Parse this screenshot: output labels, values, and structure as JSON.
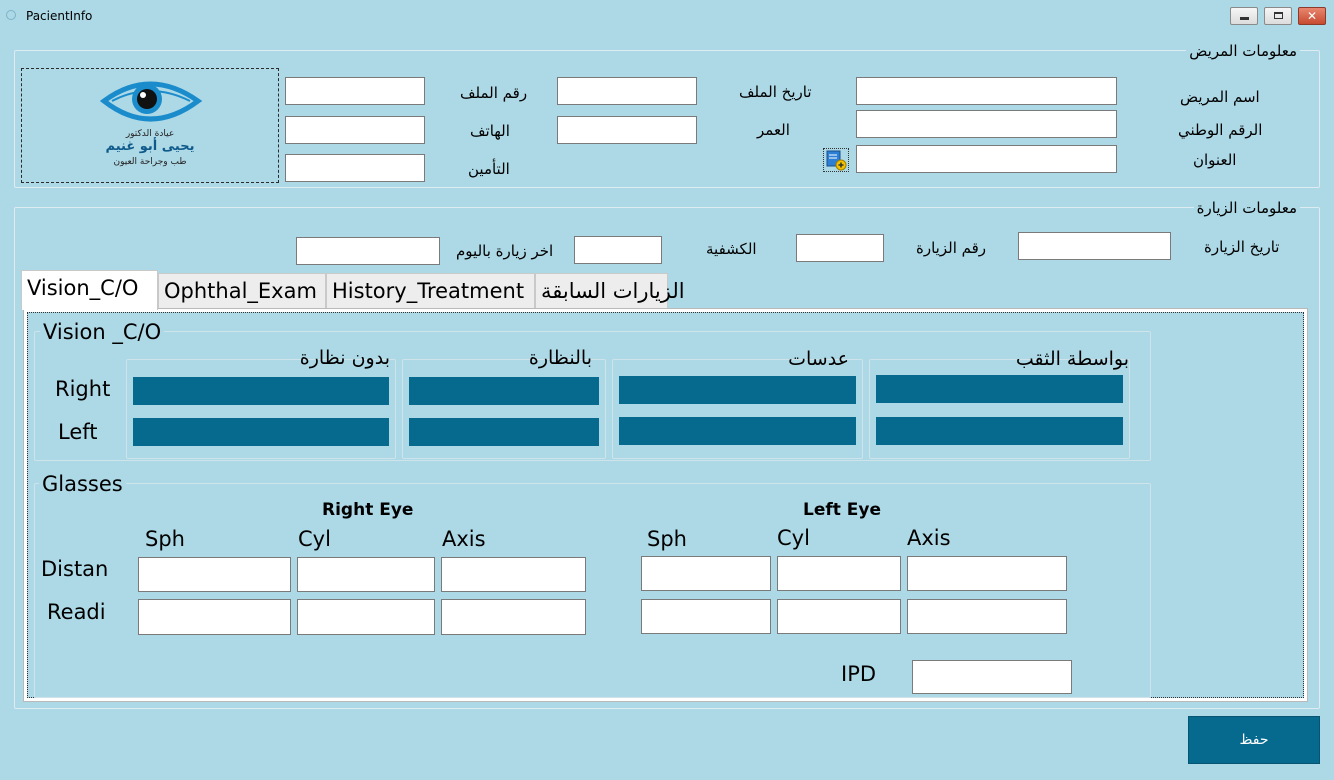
{
  "window": {
    "title": "PacientInfo"
  },
  "patient": {
    "legend": "معلومات المريض",
    "name_label": "اسم المريض",
    "national_id_label": "الرقم الوطني",
    "address_label": "العنوان",
    "file_date_label": "تاريخ الملف",
    "age_label": "العمر",
    "file_no_label": "رقم الملف",
    "phone_label": "الهاتف",
    "insurance_label": "التأمين"
  },
  "logo": {
    "line1": "عيادة الدكتور",
    "line2": "يحيى أبو غنيم",
    "line3": "طب وجراحة العيون"
  },
  "visit": {
    "legend": "معلومات الزيارة",
    "date_label": "تاريخ الزيارة",
    "visit_no_label": "رقم الزيارة",
    "fee_label": "الكشفية",
    "last_visit_label": "اخر زيارة باليوم"
  },
  "tabs": [
    {
      "label": "Vision_C/O",
      "active": true
    },
    {
      "label": "Ophthal_Exam",
      "active": false
    },
    {
      "label": "History_Treatment",
      "active": false
    },
    {
      "label": "الزيارات السابقة",
      "active": false
    }
  ],
  "vision": {
    "legend": "Vision _C/O",
    "right_label": "Right",
    "left_label": "Left",
    "columns": [
      "بدون نظارة",
      "بالنظارة",
      "عدسات",
      "بواسطة الثقب"
    ]
  },
  "glasses": {
    "legend": "Glasses",
    "right_eye_title": "Right Eye",
    "left_eye_title": "Left Eye",
    "sph": "Sph",
    "cyl": "Cyl",
    "axis": "Axis",
    "distance_label": "Distan",
    "reading_label": "Readi",
    "ipd_label": "IPD"
  },
  "save_label": "حفظ",
  "colors": {
    "background": "#add8e6",
    "accent": "#066a8f"
  }
}
